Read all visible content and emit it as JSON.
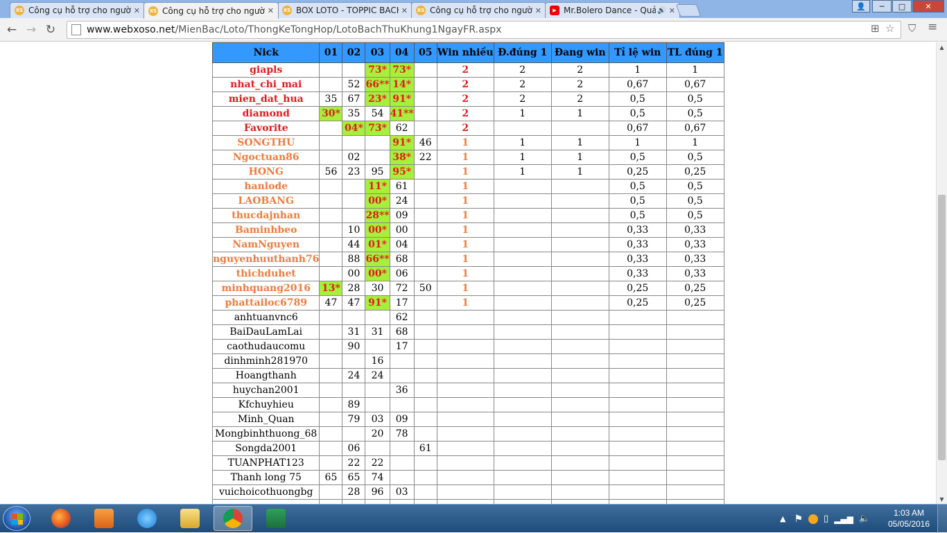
{
  "browser": {
    "tabs": [
      {
        "title": "Công cụ hỗ trợ cho người",
        "icon": "xs-icon",
        "active": false
      },
      {
        "title": "Công cụ hỗ trợ cho người",
        "icon": "xs-icon",
        "active": true
      },
      {
        "title": "BOX LOTO - TOPPIC BACH",
        "icon": "xs-icon",
        "active": false
      },
      {
        "title": "Công cụ hỗ trợ cho người",
        "icon": "xs-icon",
        "active": false
      },
      {
        "title": "Mr.Bolero Dance - Quả",
        "icon": "youtube-icon",
        "active": false
      }
    ],
    "favicon_text": "XS",
    "url_host": "www.webxoso.net",
    "url_path": "/MienBac/Loto/ThongKeTongHop/LotoBachThuKhung1NgayFR.aspx",
    "window_controls": {
      "minimize": "─",
      "maximize": "□",
      "close": "✕"
    }
  },
  "table": {
    "headers": [
      "Nick",
      "01",
      "02",
      "03",
      "04",
      "05",
      "Win nhiều",
      "Đ.đúng 1",
      "Đang win",
      "Tỉ lệ win",
      "TL đúng 1"
    ],
    "rows": [
      {
        "nick": "giapls",
        "cls": "red",
        "d": [
          "",
          "",
          "73*",
          "73*",
          ""
        ],
        "hits": [
          2,
          3
        ],
        "win": "2",
        "dd1": "2",
        "dw": "2",
        "tlw": "1",
        "tld": "1"
      },
      {
        "nick": "nhat_chi_mai",
        "cls": "red",
        "d": [
          "",
          "52",
          "66**",
          "14*",
          ""
        ],
        "hits": [
          2,
          3
        ],
        "win": "2",
        "dd1": "2",
        "dw": "2",
        "tlw": "0,67",
        "tld": "0,67"
      },
      {
        "nick": "mien_dat_hua",
        "cls": "red",
        "d": [
          "35",
          "67",
          "23*",
          "91*",
          ""
        ],
        "hits": [
          2,
          3
        ],
        "win": "2",
        "dd1": "2",
        "dw": "2",
        "tlw": "0,5",
        "tld": "0,5"
      },
      {
        "nick": "diamond",
        "cls": "red",
        "d": [
          "30*",
          "35",
          "54",
          "41**",
          ""
        ],
        "hits": [
          0,
          3
        ],
        "win": "2",
        "dd1": "1",
        "dw": "1",
        "tlw": "0,5",
        "tld": "0,5"
      },
      {
        "nick": "Favorite",
        "cls": "red",
        "d": [
          "",
          "04*",
          "73*",
          "62",
          ""
        ],
        "hits": [
          1,
          2
        ],
        "win": "2",
        "dd1": "",
        "dw": "",
        "tlw": "0,67",
        "tld": "0,67"
      },
      {
        "nick": "SONGTHU",
        "cls": "orange",
        "d": [
          "",
          "",
          "",
          "91*",
          "46"
        ],
        "hits": [
          3
        ],
        "win": "1",
        "dd1": "1",
        "dw": "1",
        "tlw": "1",
        "tld": "1"
      },
      {
        "nick": "Ngoctuan86",
        "cls": "orange",
        "d": [
          "",
          "02",
          "",
          "38*",
          "22"
        ],
        "hits": [
          3
        ],
        "win": "1",
        "dd1": "1",
        "dw": "1",
        "tlw": "0,5",
        "tld": "0,5"
      },
      {
        "nick": "HONG",
        "cls": "orange",
        "d": [
          "56",
          "23",
          "95",
          "95*",
          ""
        ],
        "hits": [
          3
        ],
        "win": "1",
        "dd1": "1",
        "dw": "1",
        "tlw": "0,25",
        "tld": "0,25"
      },
      {
        "nick": "hanlode",
        "cls": "orange",
        "d": [
          "",
          "",
          "11*",
          "61",
          ""
        ],
        "hits": [
          2
        ],
        "win": "1",
        "dd1": "",
        "dw": "",
        "tlw": "0,5",
        "tld": "0,5"
      },
      {
        "nick": "LAOBANG",
        "cls": "orange",
        "d": [
          "",
          "",
          "00*",
          "24",
          ""
        ],
        "hits": [
          2
        ],
        "win": "1",
        "dd1": "",
        "dw": "",
        "tlw": "0,5",
        "tld": "0,5"
      },
      {
        "nick": "thucdajnhan",
        "cls": "orange",
        "d": [
          "",
          "",
          "28**",
          "09",
          ""
        ],
        "hits": [
          2
        ],
        "win": "1",
        "dd1": "",
        "dw": "",
        "tlw": "0,5",
        "tld": "0,5"
      },
      {
        "nick": "Baminhbeo",
        "cls": "orange",
        "d": [
          "",
          "10",
          "00*",
          "00",
          ""
        ],
        "hits": [
          2
        ],
        "win": "1",
        "dd1": "",
        "dw": "",
        "tlw": "0,33",
        "tld": "0,33"
      },
      {
        "nick": "NamNguyen",
        "cls": "orange",
        "d": [
          "",
          "44",
          "01*",
          "04",
          ""
        ],
        "hits": [
          2
        ],
        "win": "1",
        "dd1": "",
        "dw": "",
        "tlw": "0,33",
        "tld": "0,33"
      },
      {
        "nick": "nguyenhuuthanh76",
        "cls": "orange",
        "d": [
          "",
          "88",
          "66**",
          "68",
          ""
        ],
        "hits": [
          2
        ],
        "win": "1",
        "dd1": "",
        "dw": "",
        "tlw": "0,33",
        "tld": "0,33"
      },
      {
        "nick": "thichduhet",
        "cls": "orange",
        "d": [
          "",
          "00",
          "00*",
          "06",
          ""
        ],
        "hits": [
          2
        ],
        "win": "1",
        "dd1": "",
        "dw": "",
        "tlw": "0,33",
        "tld": "0,33"
      },
      {
        "nick": "minhquang2016",
        "cls": "orange",
        "d": [
          "13*",
          "28",
          "30",
          "72",
          "50"
        ],
        "hits": [
          0
        ],
        "win": "1",
        "dd1": "",
        "dw": "",
        "tlw": "0,25",
        "tld": "0,25"
      },
      {
        "nick": "phattailoc6789",
        "cls": "orange",
        "d": [
          "47",
          "47",
          "91*",
          "17",
          ""
        ],
        "hits": [
          2
        ],
        "win": "1",
        "dd1": "",
        "dw": "",
        "tlw": "0,25",
        "tld": "0,25"
      },
      {
        "nick": "anhtuanvnc6",
        "cls": "",
        "d": [
          "",
          "",
          "",
          "62",
          ""
        ],
        "hits": [],
        "win": "",
        "dd1": "",
        "dw": "",
        "tlw": "",
        "tld": ""
      },
      {
        "nick": "BaiDauLamLai",
        "cls": "",
        "d": [
          "",
          "31",
          "31",
          "68",
          ""
        ],
        "hits": [],
        "win": "",
        "dd1": "",
        "dw": "",
        "tlw": "",
        "tld": ""
      },
      {
        "nick": "caothudaucomu",
        "cls": "",
        "d": [
          "",
          "90",
          "",
          "17",
          ""
        ],
        "hits": [],
        "win": "",
        "dd1": "",
        "dw": "",
        "tlw": "",
        "tld": ""
      },
      {
        "nick": "dinhminh281970",
        "cls": "",
        "d": [
          "",
          "",
          "16",
          "",
          ""
        ],
        "hits": [],
        "win": "",
        "dd1": "",
        "dw": "",
        "tlw": "",
        "tld": ""
      },
      {
        "nick": "Hoangthanh",
        "cls": "",
        "d": [
          "",
          "24",
          "24",
          "",
          ""
        ],
        "hits": [],
        "win": "",
        "dd1": "",
        "dw": "",
        "tlw": "",
        "tld": ""
      },
      {
        "nick": "huychan2001",
        "cls": "",
        "d": [
          "",
          "",
          "",
          "36",
          ""
        ],
        "hits": [],
        "win": "",
        "dd1": "",
        "dw": "",
        "tlw": "",
        "tld": ""
      },
      {
        "nick": "Kfchuyhieu",
        "cls": "",
        "d": [
          "",
          "89",
          "",
          "",
          ""
        ],
        "hits": [],
        "win": "",
        "dd1": "",
        "dw": "",
        "tlw": "",
        "tld": ""
      },
      {
        "nick": "Minh_Quan",
        "cls": "",
        "d": [
          "",
          "79",
          "03",
          "09",
          ""
        ],
        "hits": [],
        "win": "",
        "dd1": "",
        "dw": "",
        "tlw": "",
        "tld": ""
      },
      {
        "nick": "Mongbinhthuong_68",
        "cls": "",
        "d": [
          "",
          "",
          "20",
          "78",
          ""
        ],
        "hits": [],
        "win": "",
        "dd1": "",
        "dw": "",
        "tlw": "",
        "tld": ""
      },
      {
        "nick": "Songda2001",
        "cls": "",
        "d": [
          "",
          "06",
          "",
          "",
          "61"
        ],
        "hits": [],
        "win": "",
        "dd1": "",
        "dw": "",
        "tlw": "",
        "tld": ""
      },
      {
        "nick": "TUANPHAT123",
        "cls": "",
        "d": [
          "",
          "22",
          "22",
          "",
          ""
        ],
        "hits": [],
        "win": "",
        "dd1": "",
        "dw": "",
        "tlw": "",
        "tld": ""
      },
      {
        "nick": "Thanh long 75",
        "cls": "",
        "d": [
          "65",
          "65",
          "74",
          "",
          ""
        ],
        "hits": [],
        "win": "",
        "dd1": "",
        "dw": "",
        "tlw": "",
        "tld": ""
      },
      {
        "nick": "vuichoicothuongbg",
        "cls": "",
        "d": [
          "",
          "28",
          "96",
          "03",
          ""
        ],
        "hits": [],
        "win": "",
        "dd1": "",
        "dw": "",
        "tlw": "",
        "tld": ""
      },
      {
        "nick": "",
        "cls": "",
        "d": [
          "",
          "",
          "",
          "",
          ""
        ],
        "hits": [],
        "win": "",
        "dd1": "",
        "dw": "",
        "tlw": "",
        "tld": ""
      }
    ]
  },
  "taskbar": {
    "apps": [
      "firefox-icon",
      "media-player-icon",
      "internet-explorer-icon",
      "file-explorer-icon",
      "chrome-icon",
      "excel-icon"
    ],
    "time": "1:03 AM",
    "date": "05/05/2016"
  },
  "colors": {
    "header_bg": "#3399ff",
    "hit_bg": "#a6ef3a",
    "red": "#e21b1b",
    "orange": "#f07b3c"
  }
}
